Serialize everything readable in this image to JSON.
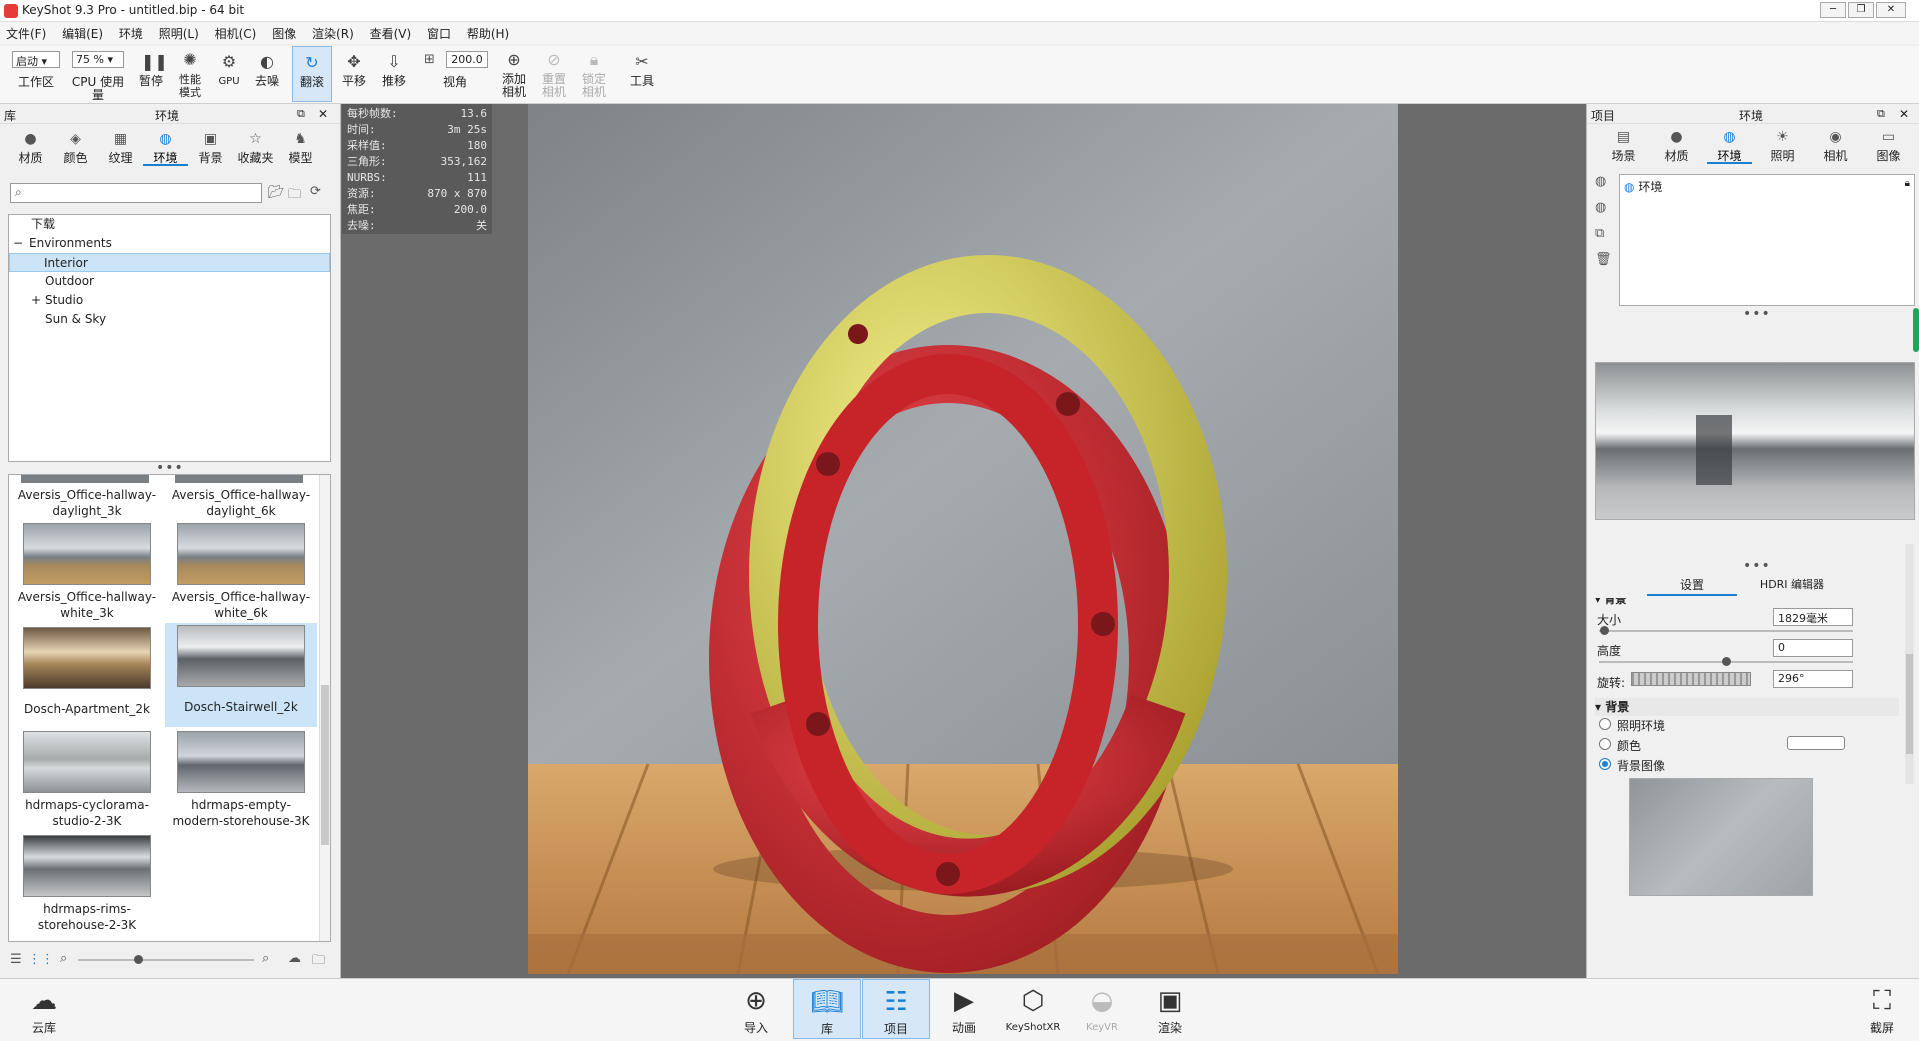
{
  "window": {
    "title": "KeyShot 9.3 Pro  - untitled.bip  - 64 bit"
  },
  "menu": [
    "文件(F)",
    "编辑(E)",
    "环境",
    "照明(L)",
    "相机(C)",
    "图像",
    "渲染(R)",
    "查看(V)",
    "窗口",
    "帮助(H)"
  ],
  "toolbar": {
    "workspace_select": "启动",
    "workspace_label": "工作区",
    "cpu_select": "75 %",
    "cpu_label": "CPU 使用量",
    "pause": "暂停",
    "perf_mode": "性能\n模式",
    "gpu": "GPU",
    "denoise": "去噪",
    "tumble": "翻滚",
    "pan": "平移",
    "dolly": "推移",
    "fov_value": "200.0",
    "fov_label": "视角",
    "add_camera": "添加\n相机",
    "reset_camera": "重置\n相机",
    "lock_camera": "锁定\n相机",
    "tools": "工具"
  },
  "library": {
    "header_left": "库",
    "header_title": "环境",
    "tabs": [
      "材质",
      "颜色",
      "纹理",
      "环境",
      "背景",
      "收藏夹",
      "模型"
    ],
    "search_placeholder": "",
    "tree": [
      "下载",
      "Environments",
      "Interior",
      "Outdoor",
      "Studio",
      "Sun & Sky"
    ],
    "thumbs": [
      {
        "line1": "Aversis_Office-hallway-",
        "line2": "daylight_3k"
      },
      {
        "line1": "Aversis_Office-hallway-",
        "line2": "daylight_6k"
      },
      {
        "line1": "Aversis_Office-hallway-",
        "line2": "white_3k"
      },
      {
        "line1": "Aversis_Office-hallway-",
        "line2": "white_6k"
      },
      {
        "line1": "Dosch-Apartment_2k",
        "line2": ""
      },
      {
        "line1": "Dosch-Stairwell_2k",
        "line2": ""
      },
      {
        "line1": "hdrmaps-cyclorama-",
        "line2": "studio-2-3K"
      },
      {
        "line1": "hdrmaps-empty-",
        "line2": "modern-storehouse-3K"
      },
      {
        "line1": "hdrmaps-rims-",
        "line2": "storehouse-2-3K"
      }
    ]
  },
  "stats": [
    {
      "k": "每秒帧数:",
      "v": "13.6"
    },
    {
      "k": "时间:",
      "v": "3m 25s"
    },
    {
      "k": "采样值:",
      "v": "180"
    },
    {
      "k": "三角形:",
      "v": "353,162"
    },
    {
      "k": "NURBS:",
      "v": "111"
    },
    {
      "k": "资源:",
      "v": "870 x 870"
    },
    {
      "k": "焦距:",
      "v": "200.0"
    },
    {
      "k": "去噪:",
      "v": "关"
    }
  ],
  "project": {
    "header_left": "项目",
    "header_title": "环境",
    "tabs": [
      "场景",
      "材质",
      "环境",
      "照明",
      "相机",
      "图像"
    ],
    "env_item": "环境",
    "subtabs": [
      "设置",
      "HDRI 编辑器"
    ],
    "section_cut": "背景",
    "size_label": "大小",
    "size_value": "1829毫米",
    "size_slider": 0.02,
    "height_label": "高度",
    "height_value": "0",
    "height_slider": 0.5,
    "rotation_label": "旋转:",
    "rotation_value": "296°",
    "bg_section": "背景",
    "radio_lighting": "照明环境",
    "radio_color": "颜色",
    "radio_bgimage": "背景图像"
  },
  "bottom": [
    "云库",
    "导入",
    "库",
    "项目",
    "动画",
    "KeyShotXR",
    "KeyVR",
    "渲染",
    "截屏"
  ],
  "colors": {
    "accent": "#1b7fd4",
    "ring_red": "#d42a30",
    "ring_yellow": "#e2dc55"
  }
}
